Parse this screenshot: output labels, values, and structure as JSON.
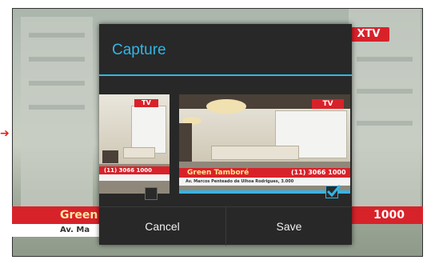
{
  "background": {
    "channel_logo": "XTV",
    "lower_third_left": "Green",
    "lower_third_right": "1000",
    "lower_third_sub": "Av. Ma"
  },
  "dialog": {
    "title": "Capture",
    "thumbnails": [
      {
        "logo": "TV",
        "phone": "(11) 3066 1000",
        "caption": "",
        "checked": false
      },
      {
        "logo": "TV",
        "title": "Green Tamboré",
        "phone": "(11) 3066 1000",
        "caption": "Av. Marcos Penteado de Ulhoa Rodrigues, 3.000",
        "checked": true
      }
    ],
    "buttons": {
      "cancel": "Cancel",
      "save": "Save"
    }
  },
  "colors": {
    "accent": "#33b5e5",
    "dialog_bg": "#282828",
    "brand_red": "#d8222a"
  },
  "icons": {
    "arrow": "arrow-right-icon",
    "check": "checkmark-icon"
  }
}
